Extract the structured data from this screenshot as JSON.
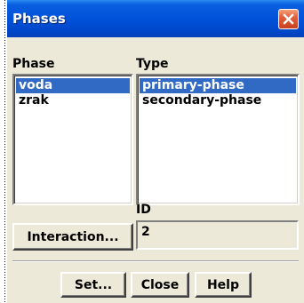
{
  "window": {
    "title": "Phases"
  },
  "phase_list": {
    "label": "Phase",
    "items": [
      {
        "label": "voda",
        "selected": true
      },
      {
        "label": "zrak",
        "selected": false
      }
    ]
  },
  "type_list": {
    "label": "Type",
    "items": [
      {
        "label": "primary-phase",
        "selected": true
      },
      {
        "label": "secondary-phase",
        "selected": false
      }
    ]
  },
  "id_field": {
    "label": "ID",
    "value": "2"
  },
  "buttons": {
    "interaction": "Interaction...",
    "set": "Set...",
    "close": "Close",
    "help": "Help"
  },
  "colors": {
    "title_bar": "#0050d8",
    "selection": "#316ac5",
    "dialog_bg": "#ece9d8",
    "close_button": "#e0603a"
  }
}
